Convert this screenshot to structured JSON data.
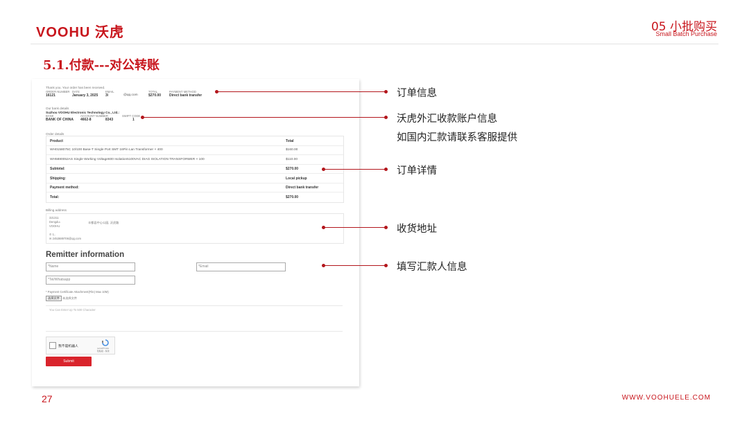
{
  "header": {
    "logo": "VOOHU 沃虎",
    "section_number": "05 小批购买",
    "section_english": "Small Batch Purchase",
    "title": "5.1.付款---对公转账"
  },
  "screenshot": {
    "thanks": "Thank you. Your order has been received.",
    "order_meta_labels": [
      "ORDER NUMBER",
      "DATE",
      "EMAIL",
      "TOTAL",
      "PAYMENT METHOD"
    ],
    "order_meta": {
      "number": "16121",
      "date": "January 3, 2025",
      "user": "3\\",
      "email": "@qq.com",
      "total": "$270.00",
      "method": "Direct bank transfer"
    },
    "bank_title": "Our bank details",
    "bank_company": "Suzhou VOOHU Electronic Technology Co., Ltd.:",
    "bank_labels": [
      "BANK",
      "ACCOUNT NUMBER",
      "SWIFT CODE"
    ],
    "bank_values": {
      "bank": "BANK OF CHINA",
      "account1": "4662-8",
      "account2": "8343",
      "swift": "1"
    },
    "order_details_title": "Order details",
    "table_headers": {
      "product": "Product",
      "total": "Total"
    },
    "table_rows": [
      {
        "label": "WH0158075C 10/100 Base-T Single Port SMT 16Pin Lan Transformer × 400",
        "value": "$160.00",
        "bold": false
      },
      {
        "label": "WH5880052AS Single Working Voltage600 Isolation5100VAC DIAG ISOLATION TRANSFORMER × 100",
        "value": "$110.00",
        "bold": false
      },
      {
        "label": "Subtotal:",
        "value": "$270.00",
        "bold": true
      },
      {
        "label": "Shipping:",
        "value": "Local pickup",
        "bold": true
      },
      {
        "label": "Payment method:",
        "value": "Direct bank transfer",
        "bold": true
      },
      {
        "label": "Total:",
        "value": "$270.00",
        "bold": true
      }
    ],
    "billing_title": "Billing address",
    "billing_lines": [
      "321311",
      "Dengdu↓",
      "VOOHU"
    ],
    "billing_mid": "丰都县中心公园, 沃虎路",
    "billing_phone": "✆ 1..",
    "billing_email": "✉ 2453689706@qq.com",
    "remitter_title": "Remitter information",
    "placeholders": {
      "name": "*Name",
      "email": "*Email",
      "tel": "*Tel/Whatsapp"
    },
    "upload_label": "* Payment Certificate Attachment(File) Max 10M)",
    "choose_file": "选择文件",
    "no_file": "未选择文件",
    "textarea_placeholder": "You Can Enter Up To 500 Character",
    "captcha_label": "我不是机器人",
    "captcha_brand": "reCAPTCHA",
    "captcha_terms": "隐私权 - 条款",
    "submit": "Submit"
  },
  "annotations": [
    "订单信息",
    "沃虎外汇收款账户信息",
    "如国内汇款请联系客服提供",
    "订单详情",
    "收货地址",
    "填写汇款人信息"
  ],
  "footer": {
    "page": "27",
    "website": "WWW.VOOHUELE.COM"
  },
  "colors": {
    "brand_red": "#c8161d",
    "line_red": "#b3161c",
    "submit_red": "#d9242c"
  }
}
